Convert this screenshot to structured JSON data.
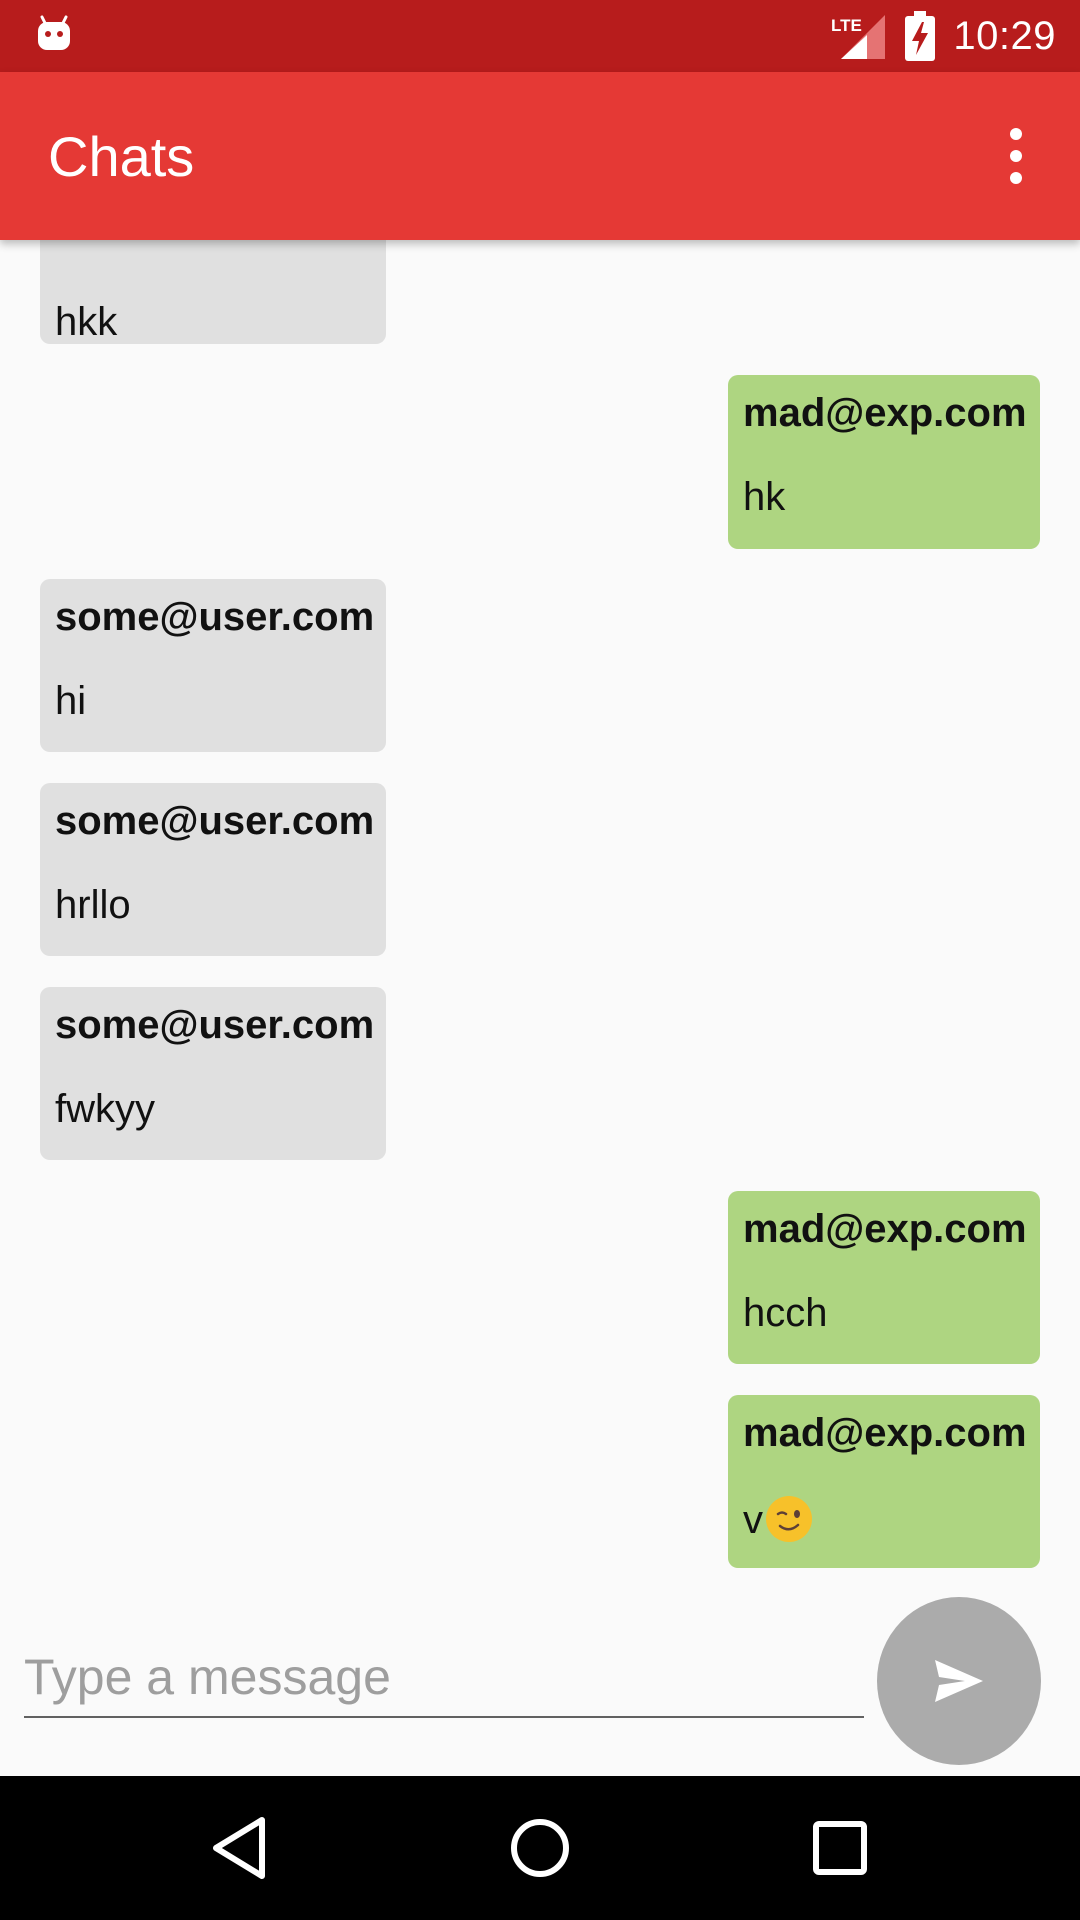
{
  "status_bar": {
    "time": "10:29",
    "network": "LTE",
    "icons": [
      "android-debug-icon",
      "lte-signal-icon",
      "battery-charging-icon"
    ]
  },
  "app_bar": {
    "title": "Chats",
    "menu_icon": "more-vert-icon"
  },
  "messages": [
    {
      "sender": "",
      "text": "hkk",
      "direction": "incoming"
    },
    {
      "sender": "mad@exp.com",
      "text": "hk",
      "direction": "outgoing"
    },
    {
      "sender": "some@user.com",
      "text": "hi",
      "direction": "incoming"
    },
    {
      "sender": "some@user.com",
      "text": "hrllo",
      "direction": "incoming"
    },
    {
      "sender": "some@user.com",
      "text": "fwkyy",
      "direction": "incoming"
    },
    {
      "sender": "mad@exp.com",
      "text": "hcch",
      "direction": "outgoing"
    },
    {
      "sender": "mad@exp.com",
      "text": "v",
      "direction": "outgoing",
      "emoji": "winking-face"
    }
  ],
  "composer": {
    "placeholder": "Type a message",
    "value": "",
    "send_icon": "send-icon"
  },
  "nav_bar": {
    "icons": [
      "back-icon",
      "home-icon",
      "recents-icon"
    ]
  },
  "colors": {
    "status_bar": "#b71c1c",
    "app_bar": "#e53935",
    "incoming_bubble": "#e0e0e0",
    "outgoing_bubble": "#aed581",
    "send_button": "#ababab",
    "background": "#fafafa"
  }
}
